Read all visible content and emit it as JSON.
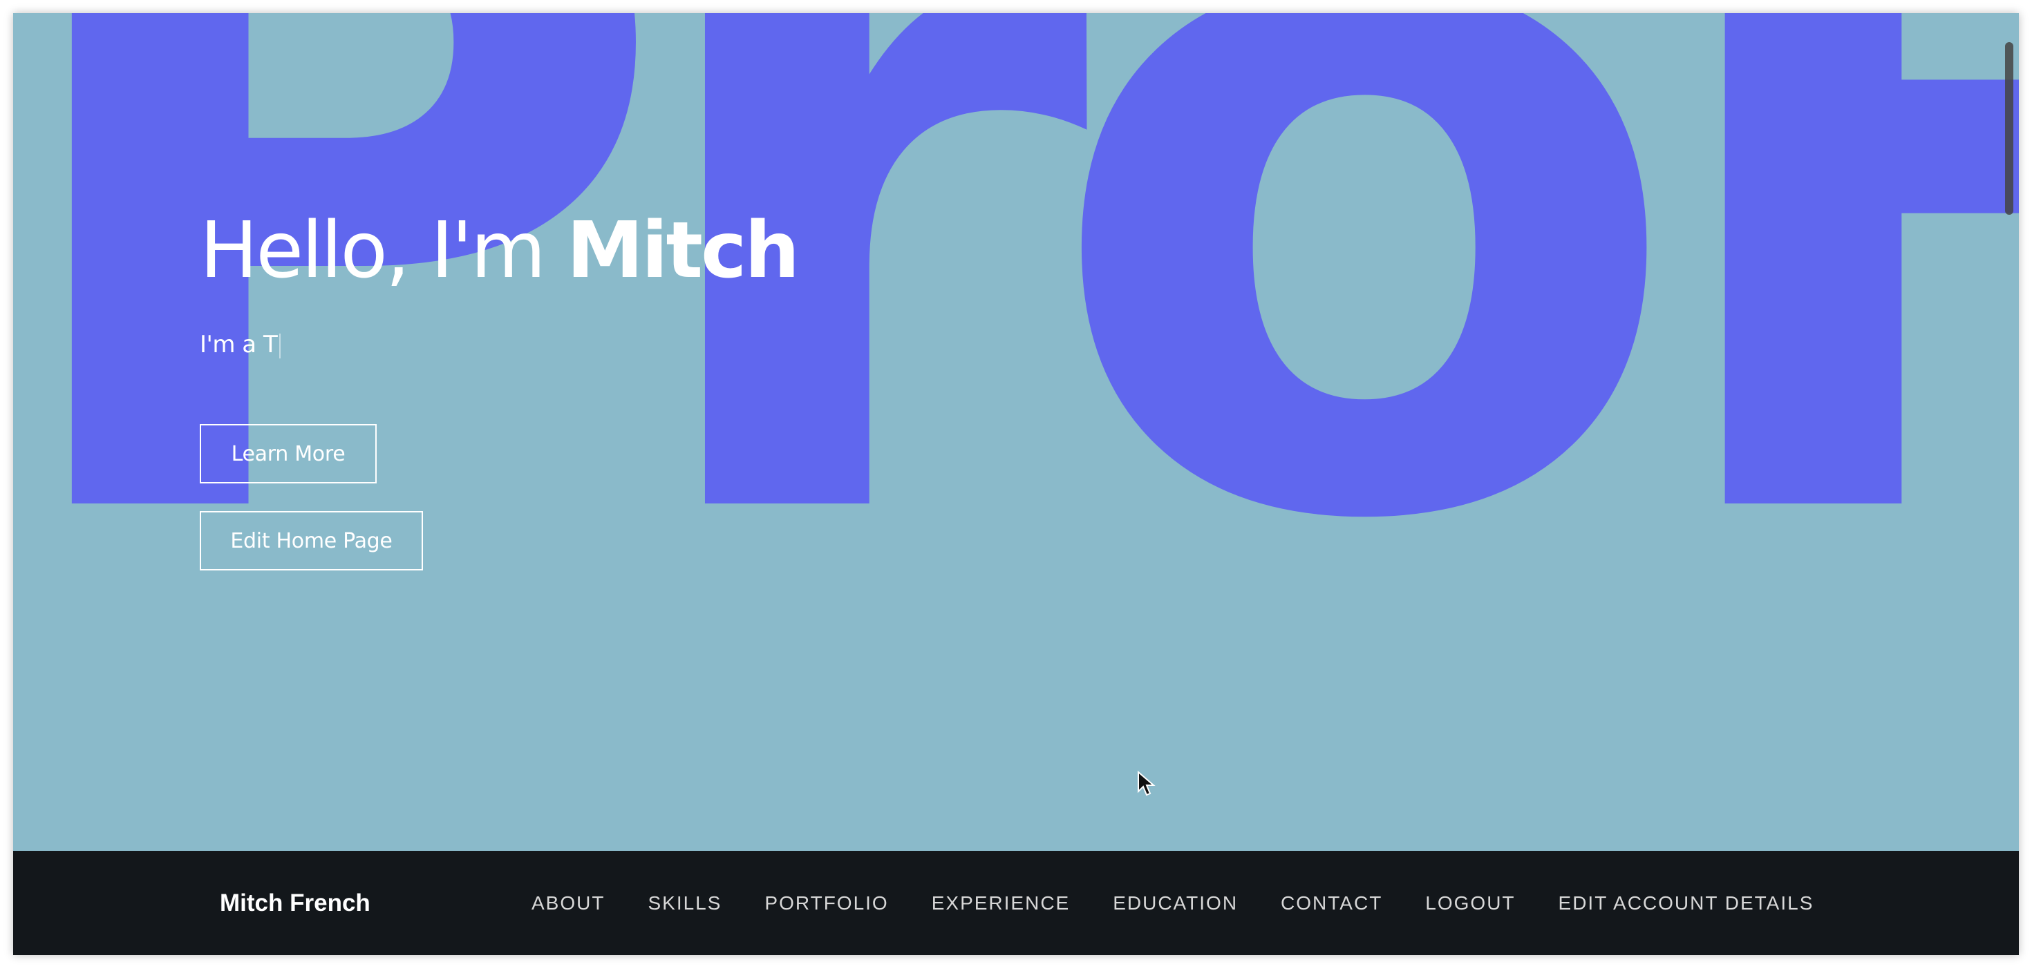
{
  "hero": {
    "background_word": "ProFo",
    "title_prefix": "Hello, I'm ",
    "title_name": "Mitch",
    "subtitle": "I'm a T",
    "learn_more_label": "Learn More",
    "edit_home_label": "Edit Home Page"
  },
  "navbar": {
    "brand": "Mitch French",
    "items": [
      {
        "label": "ABOUT"
      },
      {
        "label": "SKILLS"
      },
      {
        "label": "PORTFOLIO"
      },
      {
        "label": "EXPERIENCE"
      },
      {
        "label": "EDUCATION"
      },
      {
        "label": "CONTACT"
      },
      {
        "label": "LOGOUT"
      },
      {
        "label": "EDIT ACCOUNT DETAILS"
      }
    ]
  },
  "colors": {
    "hero_background": "#8abaca",
    "hero_letters": "#5f65f0",
    "navbar_background": "#13171b",
    "text": "#ffffff"
  },
  "icons": {
    "cursor": "mouse-pointer-icon"
  }
}
